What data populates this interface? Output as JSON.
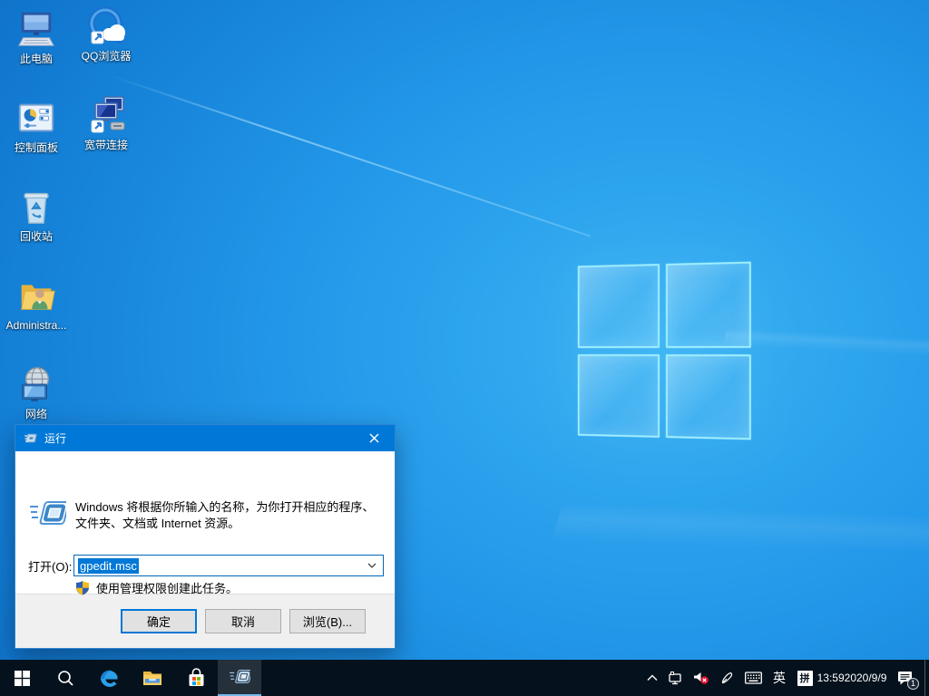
{
  "colors": {
    "accent": "#0078d7",
    "taskbar_bg": "#05121d",
    "titlebar_bg": "#0078d7",
    "selection_bg": "#0078d7",
    "dialog_footer_bg": "#f0f0f0"
  },
  "desktop": {
    "icons": [
      {
        "label": "此电脑",
        "icon": "this-pc-monitor"
      },
      {
        "label": "QQ浏览器",
        "icon": "qq-browser-q-cloud"
      },
      {
        "label": "控制面板",
        "icon": "control-panel"
      },
      {
        "label": "宽带连接",
        "icon": "broadband-connection-monitors"
      },
      {
        "label": "回收站",
        "icon": "recycle-bin"
      },
      {
        "label": "Administra...",
        "icon": "user-folder"
      },
      {
        "label": "网络",
        "icon": "network-globe-monitor"
      }
    ]
  },
  "run_dialog": {
    "title": "运行",
    "title_icon": "run-window-icon",
    "close_icon": "close-icon",
    "body_icon": "run-window-icon",
    "description_line1": "Windows 将根据你所输入的名称，为你打开相应的程序、",
    "description_line2": "文件夹、文档或 Internet 资源。",
    "open_label": "打开(O):",
    "input_value": "gpedit.msc",
    "dropdown_icon": "chevron-down-icon",
    "admin_icon": "uac-shield-icon",
    "admin_note": "使用管理权限创建此任务。",
    "buttons": {
      "ok": "确定",
      "cancel": "取消",
      "browse": "浏览(B)..."
    }
  },
  "taskbar": {
    "left_icons": [
      "start-windows-flag",
      "search-magnifier",
      "edge-browser",
      "file-explorer-folder",
      "microsoft-store-bag",
      "run-window-active"
    ],
    "active_app": "run"
  },
  "tray": {
    "icons": [
      "chevron-up",
      "network-ethernet",
      "volume-muted",
      "pen-ink",
      "touch-keyboard"
    ],
    "lang": "英",
    "ime": "拼",
    "time": "13:59",
    "date": "2020/9/9",
    "badge": "1",
    "action_center_icon": "notification-bubble"
  }
}
